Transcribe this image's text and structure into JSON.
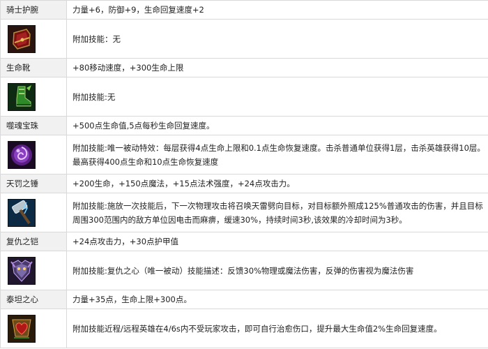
{
  "items": [
    {
      "name": "骑士护腕",
      "stats": "力量+6，防御+9，生命回复速度+2",
      "icon": "knight-bracer-icon",
      "skill": "附加技能：无"
    },
    {
      "name": "生命靴",
      "stats": "+80移动速度，+300生命上限",
      "icon": "life-boots-icon",
      "skill": "附加技能:无"
    },
    {
      "name": "噬魂宝珠",
      "stats": "+500点生命值,5点每秒生命回复速度。",
      "icon": "soul-orb-icon",
      "skill": "附加技能:唯一被动特效：每层获得4点生命上限和0.1点生命恢复速度。击杀普通单位获得1层，击杀英雄获得10层。最高获得400点生命和10点生命恢复速度"
    },
    {
      "name": "天罚之锤",
      "stats": "+200生命，+150点魔法，+15点法术强度，+24点攻击力。",
      "icon": "punishment-hammer-icon",
      "skill": "附加技能:施放一次技能后，下一次物理攻击将召唤天雷劈向目标，对目标额外照成125%普通攻击的伤害，并且目标周围300范围内的敌方单位因电击而麻痹，缓速30%，持续时间3秒,该效果的冷却时间为3秒。"
    },
    {
      "name": "复仇之铠",
      "stats": "+24点攻击力，+30点护甲值",
      "icon": "vengeance-armor-icon",
      "skill": "附加技能:复仇之心（唯一被动）技能描述：反馈30%物理或魔法伤害，反弹的伤害视为魔法伤害"
    },
    {
      "name": "泰坦之心",
      "stats": "力量+35点，生命上限+300点。",
      "icon": "titan-heart-icon",
      "skill": "附加技能近程/远程英雄在4/6s内不受玩家攻击，即可自行治愈伤口，提升最大生命值2%生命回复速度。"
    }
  ]
}
